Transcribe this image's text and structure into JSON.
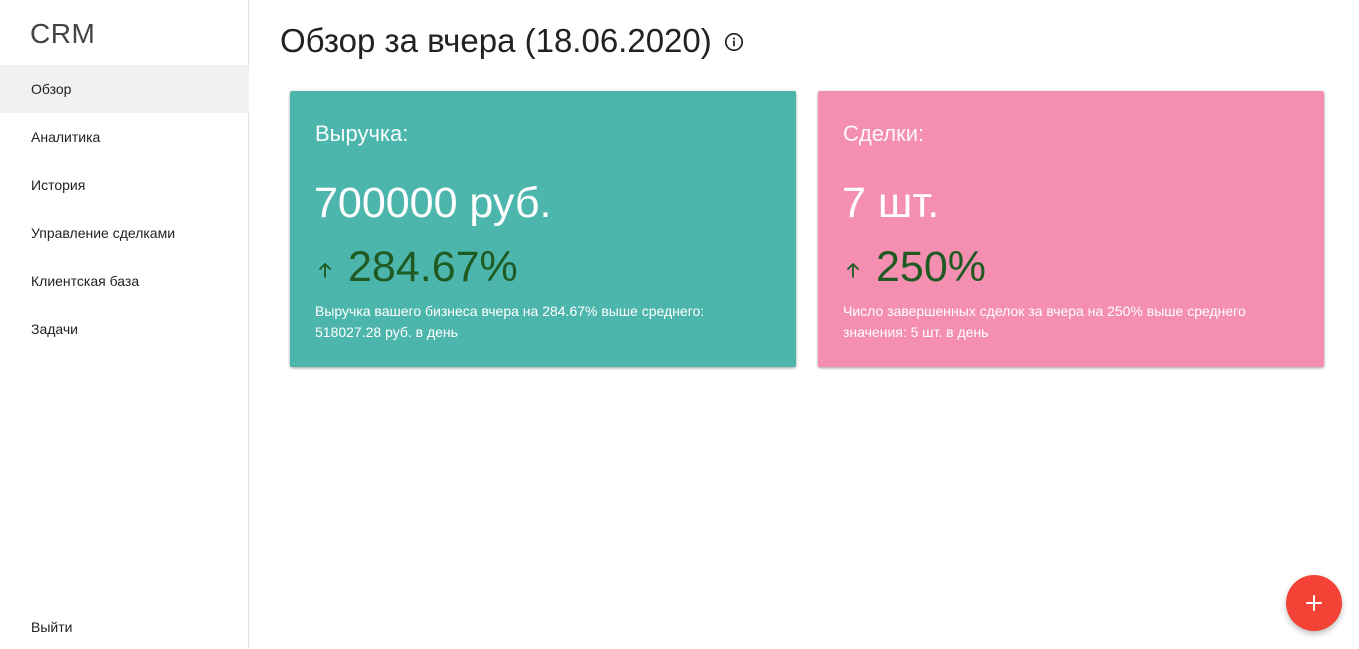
{
  "app": {
    "title": "CRM"
  },
  "sidebar": {
    "items": [
      {
        "label": "Обзор",
        "active": true
      },
      {
        "label": "Аналитика",
        "active": false
      },
      {
        "label": "История",
        "active": false
      },
      {
        "label": "Управление сделками",
        "active": false
      },
      {
        "label": "Клиентская база",
        "active": false
      },
      {
        "label": "Задачи",
        "active": false
      }
    ],
    "logout_label": "Выйти"
  },
  "header": {
    "title": "Обзор за вчера (18.06.2020)",
    "info_icon": "info-icon"
  },
  "cards": [
    {
      "label": "Выручка:",
      "value": "700000 руб.",
      "change": "284.67%",
      "change_direction": "up",
      "description": "Выручка вашего бизнеса вчера на 284.67% выше среднего: 518027.28 руб. в день",
      "color": "#4db6ac"
    },
    {
      "label": "Сделки:",
      "value": "7 шт.",
      "change": "250%",
      "change_direction": "up",
      "description": "Число завершенных сделок за вчера на 250% выше среднего значения: 5 шт. в день",
      "color": "#f48fb1"
    }
  ],
  "fab": {
    "icon": "plus-icon",
    "color": "#f44336"
  },
  "colors": {
    "change_text": "#1f5a22",
    "active_nav_bg": "#f1f1f1"
  }
}
